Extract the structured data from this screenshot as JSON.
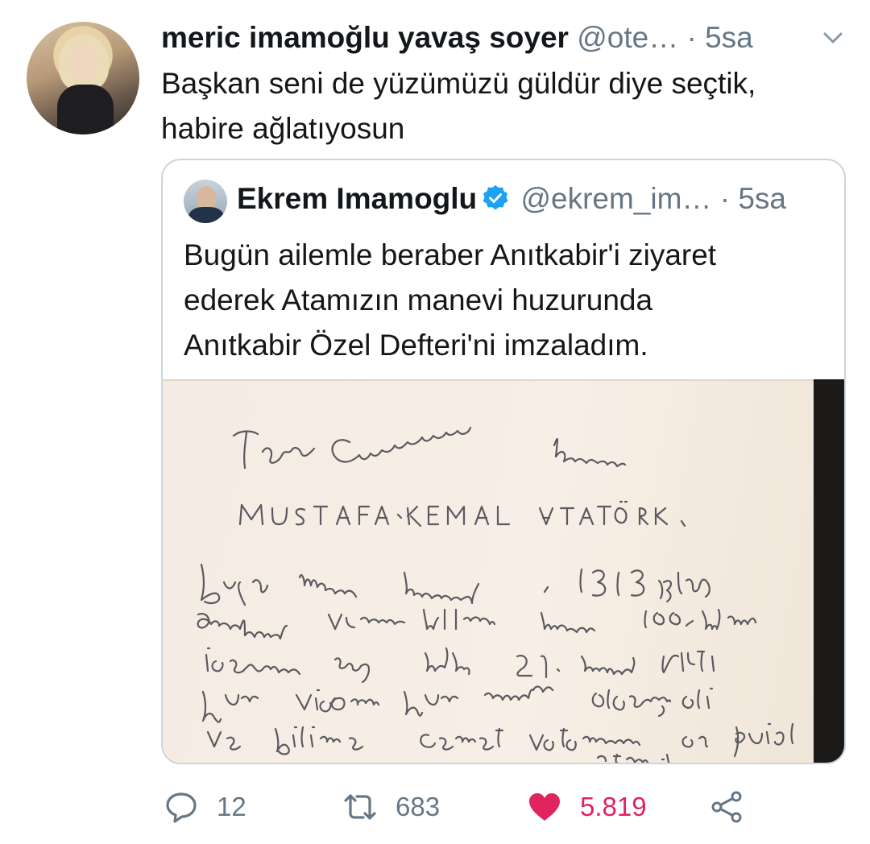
{
  "tweet": {
    "author_name": "meric imamoğlu yavaş soyer",
    "handle": "@ote…",
    "separator": "·",
    "time": "5sa",
    "text_lines": [
      "Başkan seni de yüzümüzü güldür diye seçtik,",
      "habire ağlatıyosun"
    ]
  },
  "quoted": {
    "author_name": "Ekrem Imamoglu",
    "handle": "@ekrem_im…",
    "separator": "·",
    "time": "5sa",
    "verified": true,
    "text_lines": [
      "Bugün ailemle beraber Anıtkabir'i ziyaret",
      "ederek Atamızın manevi huzurunda",
      "Anıtkabir Özel Defteri'ni imzaladım."
    ],
    "media": {
      "handwriting_lines": [
        "Türkiye Cumhuriyeti'nin Kurucusu",
        "MUSTAFA KEMAL ATATÜRK,",
        "Bugün manevi huzurunda, 1919 yılında",
        "başlattığınız Kuvva-i Milliye ruhunun 100. yılının",
        "içerisinde aynı ruhla 21. yüzyılda fikri",
        "hür vicdanı hür nesiller olarak; akıl",
        "ve bilimle cennet vatanımızın en güzel",
        "tarihi"
      ]
    }
  },
  "actions": {
    "reply_count": "12",
    "retweet_count": "683",
    "like_count": "5.819"
  },
  "colors": {
    "secondary_text": "#657786",
    "like": "#e0245e",
    "verified": "#1da1f2",
    "border": "#ccd6dd"
  },
  "icons": [
    "chevron-down-icon",
    "verified-badge-icon",
    "reply-icon",
    "retweet-icon",
    "like-icon",
    "share-icon"
  ]
}
